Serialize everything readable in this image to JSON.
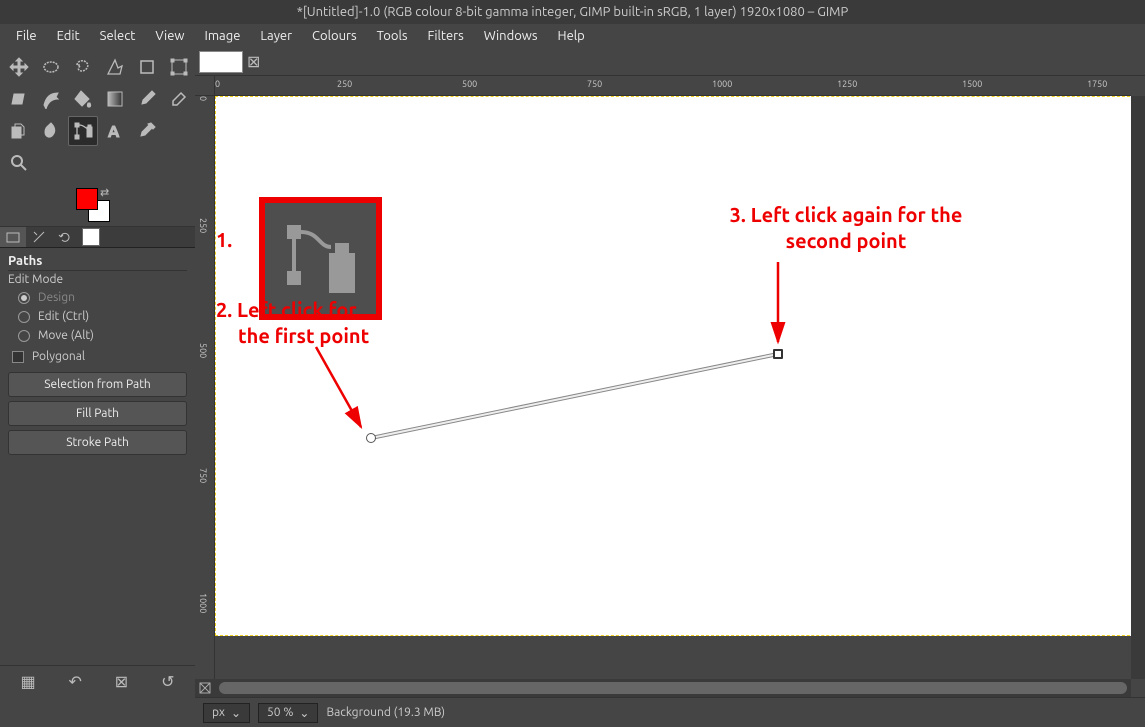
{
  "title": "*[Untitled]-1.0 (RGB colour 8-bit gamma integer, GIMP built-in sRGB, 1 layer) 1920x1080 – GIMP",
  "menu": [
    "File",
    "Edit",
    "Select",
    "View",
    "Image",
    "Layer",
    "Colours",
    "Tools",
    "Filters",
    "Windows",
    "Help"
  ],
  "tools": [
    {
      "name": "move-tool"
    },
    {
      "name": "ellipse-select-tool"
    },
    {
      "name": "free-select-tool"
    },
    {
      "name": "fuzzy-select-tool"
    },
    {
      "name": "crop-tool"
    },
    {
      "name": "unified-transform-tool"
    },
    {
      "name": "rotate-tool"
    },
    {
      "name": "scale-tool"
    },
    {
      "name": "bucket-fill-tool"
    },
    {
      "name": "gradient-tool"
    },
    {
      "name": "paintbrush-tool"
    },
    {
      "name": "eraser-tool"
    },
    {
      "name": "clone-tool"
    },
    {
      "name": "smudge-tool"
    },
    {
      "name": "paths-tool",
      "active": true
    },
    {
      "name": "text-tool"
    },
    {
      "name": "color-picker-tool"
    },
    {
      "name": "empty"
    },
    {
      "name": "zoom-tool"
    }
  ],
  "options": {
    "section": "Paths",
    "subsection": "Edit Mode",
    "modes": [
      {
        "label": "Design",
        "selected": true,
        "disabled": true
      },
      {
        "label": "Edit (Ctrl)",
        "selected": false
      },
      {
        "label": "Move (Alt)",
        "selected": false
      }
    ],
    "polygonal": "Polygonal",
    "buttons": [
      "Selection from Path",
      "Fill Path",
      "Stroke Path"
    ]
  },
  "ruler_h": [
    "0",
    "250",
    "500",
    "750",
    "1000",
    "1250",
    "1500",
    "1750"
  ],
  "ruler_v": [
    "0",
    "250",
    "500",
    "750",
    "1000"
  ],
  "status": {
    "unit": "px",
    "zoom": "50 %",
    "label": "Background (19.3 MB)"
  },
  "annotations": {
    "a1": "1.",
    "a2_l1": "2. Left click for",
    "a2_l2": "the first point",
    "a3_l1": "3. Left click again for the",
    "a3_l2": "second point"
  }
}
